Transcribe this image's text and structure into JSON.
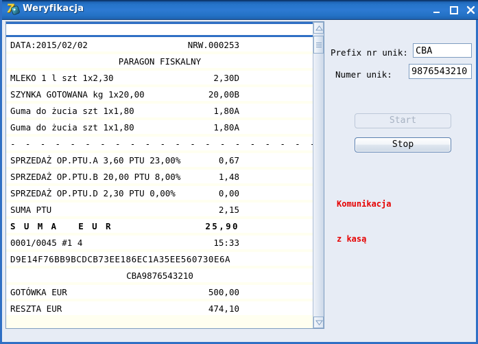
{
  "window": {
    "title": "Weryfikacja",
    "icon": "app-seven-icon",
    "controls": {
      "minimize": "minimize-icon",
      "maximize": "maximize-icon",
      "close": "close-icon"
    },
    "colors": {
      "titlebar_blue": "#2573c8",
      "frame_border": "#2f6fc4",
      "panel_background": "#e7ecf5",
      "status_red": "#e60000",
      "row_alt": "#fffff0"
    }
  },
  "receipt": {
    "rows": [
      {
        "label": "DATA:2015/02/02",
        "amount": "NRW.000253",
        "style": "normal"
      },
      {
        "label": "PARAGON FISKALNY",
        "amount": "",
        "style": "center"
      },
      {
        "label": "MLEKO 1 l szt 1x2,30",
        "amount": "2,30D",
        "style": "normal"
      },
      {
        "label": "SZYNKA GOTOWANA kg 1x20,00",
        "amount": "20,00B",
        "style": "normal"
      },
      {
        "label": "Guma do żucia szt 1x1,80",
        "amount": "1,80A",
        "style": "normal"
      },
      {
        "label": "Guma do żucia szt 1x1,80",
        "amount": "1,80A",
        "style": "normal"
      },
      {
        "label": "- - - - - - - - - - - - - - - - - - - - - -",
        "amount": "",
        "style": "dashline"
      },
      {
        "label": "SPRZEDAŻ OP.PTU.A 3,60 PTU 23,00%",
        "amount": "0,67",
        "style": "normal"
      },
      {
        "label": "SPRZEDAŻ OP.PTU.B 20,00 PTU 8,00%",
        "amount": "1,48",
        "style": "normal"
      },
      {
        "label": "SPRZEDAŻ OP.PTU.D 2,30 PTU 0,00%",
        "amount": "0,00",
        "style": "normal"
      },
      {
        "label": "SUMA PTU",
        "amount": "2,15",
        "style": "normal"
      },
      {
        "label": "S U M A   E U R",
        "amount": "25,90",
        "style": "bold"
      },
      {
        "label": "0001/0045 #1 4",
        "amount": "15:33",
        "style": "normal"
      },
      {
        "label": "D9E14F76BB9BCDCB73EE186EC1A35EE560730E6A",
        "amount": "",
        "style": "wide"
      },
      {
        "label": "CBA9876543210",
        "amount": "",
        "style": "center"
      },
      {
        "label": "GOTÓWKA EUR",
        "amount": "500,00",
        "style": "normal"
      },
      {
        "label": "RESZTA EUR",
        "amount": "474,10",
        "style": "normal"
      }
    ],
    "scrollbar": {
      "up_arrow": "scroll-up-icon",
      "down_arrow": "scroll-down-icon"
    }
  },
  "side_panel": {
    "prefix_label": "Prefix nr unik:",
    "prefix_value": "CBA",
    "number_label": "Numer unik:",
    "number_value": "9876543210",
    "start_button": "Start",
    "start_enabled": false,
    "stop_button": "Stop",
    "stop_enabled": true,
    "status_line1": "Komunikacja",
    "status_line2": "z kasą"
  }
}
